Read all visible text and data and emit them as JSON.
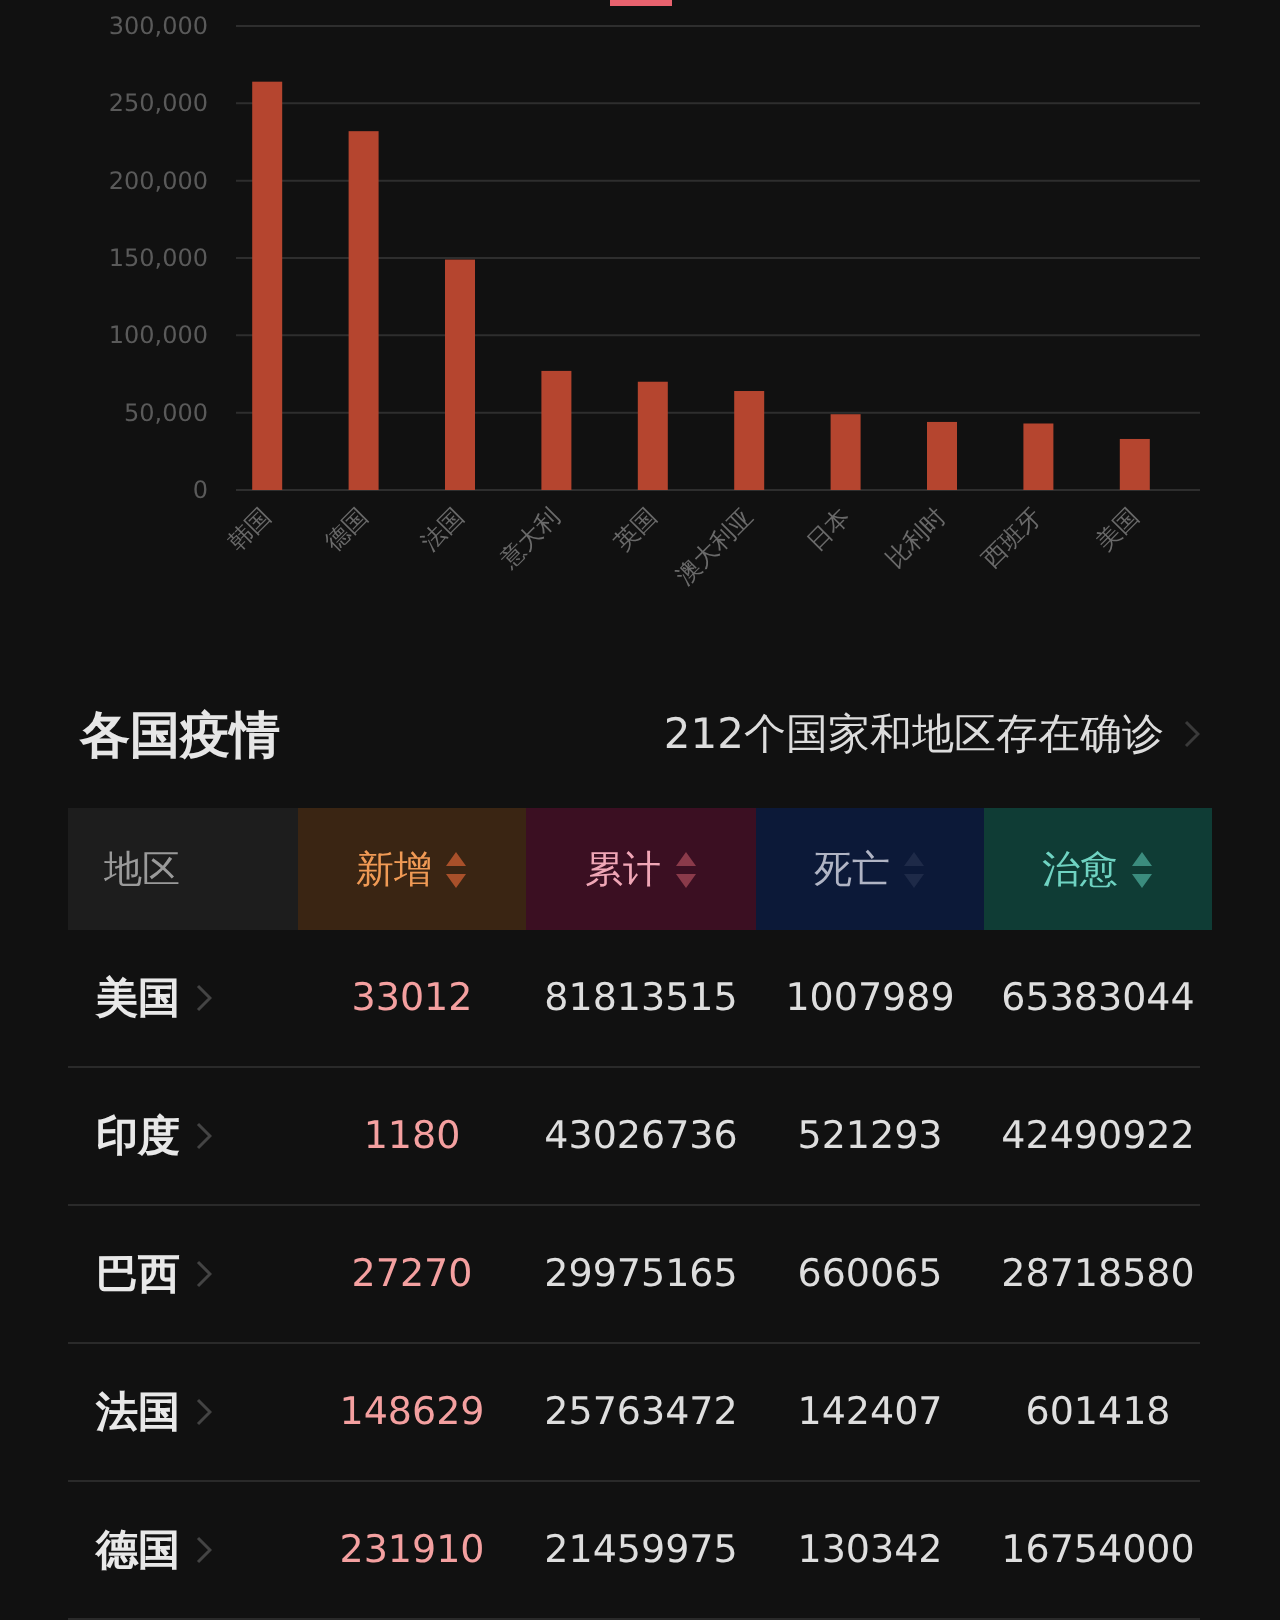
{
  "chart": {
    "chart_data": {
      "type": "bar",
      "categories": [
        "韩国",
        "德国",
        "法国",
        "意大利",
        "英国",
        "澳大利亚",
        "日本",
        "比利时",
        "西班牙",
        "美国"
      ],
      "values": [
        264000,
        232000,
        149000,
        77000,
        70000,
        64000,
        49000,
        44000,
        43000,
        33000
      ],
      "grid": true,
      "ylim": [
        0,
        300000
      ],
      "yticks": [
        {
          "value": 0,
          "label": "0"
        },
        {
          "value": 50000,
          "label": "50,000"
        },
        {
          "value": 100000,
          "label": "100,000"
        },
        {
          "value": 150000,
          "label": "150,000"
        },
        {
          "value": 200000,
          "label": "200,000"
        },
        {
          "value": 250000,
          "label": "250,000"
        },
        {
          "value": 300000,
          "label": "300,000"
        }
      ]
    }
  },
  "section": {
    "title": "各国疫情",
    "summary": "212个国家和地区存在确诊"
  },
  "table": {
    "columns": [
      {
        "label": "地区",
        "kind": "region"
      },
      {
        "label": "新增",
        "kind": "new"
      },
      {
        "label": "累计",
        "kind": "total"
      },
      {
        "label": "死亡",
        "kind": "deaths"
      },
      {
        "label": "治愈",
        "kind": "cured"
      }
    ],
    "rows": [
      {
        "region": "美国",
        "new": "33012",
        "total": "81813515",
        "deaths": "1007989",
        "cured": "65383044"
      },
      {
        "region": "印度",
        "new": "1180",
        "total": "43026736",
        "deaths": "521293",
        "cured": "42490922"
      },
      {
        "region": "巴西",
        "new": "27270",
        "total": "29975165",
        "deaths": "660065",
        "cured": "28718580"
      },
      {
        "region": "法国",
        "new": "148629",
        "total": "25763472",
        "deaths": "142407",
        "cured": "601418"
      },
      {
        "region": "德国",
        "new": "231910",
        "total": "21459975",
        "deaths": "130342",
        "cured": "16754000"
      }
    ]
  }
}
